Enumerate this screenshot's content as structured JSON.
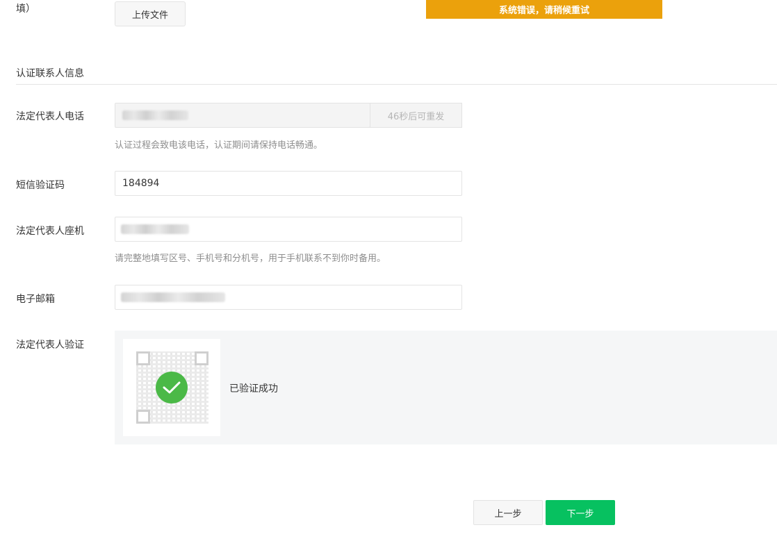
{
  "top": {
    "label_fragment": "填）",
    "upload_button": "上传文件"
  },
  "toast": {
    "message": "系统错误，请稍候重试",
    "color": "#eba10c"
  },
  "section": {
    "title": "认证联系人信息"
  },
  "phone": {
    "label": "法定代表人电话",
    "resend_button": "46秒后可重发",
    "hint": "认证过程会致电该电话，认证期间请保持电话畅通。"
  },
  "sms": {
    "label": "短信验证码",
    "value": "184894"
  },
  "landline": {
    "label": "法定代表人座机",
    "hint": "请完整地填写区号、手机号和分机号，用于手机联系不到你时备用。"
  },
  "email": {
    "label": "电子邮箱"
  },
  "verify": {
    "label": "法定代表人验证",
    "status": "已验证成功",
    "status_color": "#4bb947"
  },
  "footer": {
    "prev_button": "上一步",
    "next_button": "下一步",
    "accent": "#07c160"
  }
}
